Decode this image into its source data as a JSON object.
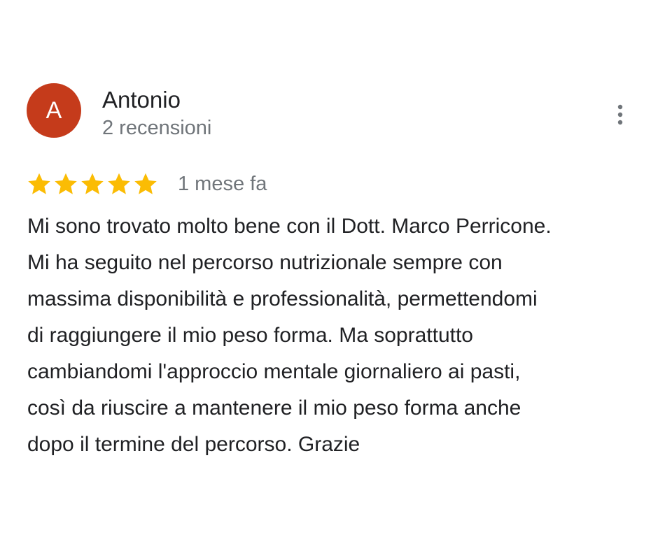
{
  "review": {
    "author": {
      "initial": "A",
      "name": "Antonio",
      "review_count": "2 recensioni",
      "avatar_color": "#c53b1b"
    },
    "more_icon": "more-vertical-icon",
    "rating": {
      "stars": 5,
      "max": 5,
      "icon": "star-icon",
      "color": "#fbbc04"
    },
    "date": "1 mese fa",
    "text_lines": [
      "Mi sono trovato molto bene con il Dott. Marco Perricone.",
      "Mi ha seguito nel percorso nutrizionale sempre con",
      "massima disponibilità e professionalità, permettendomi",
      "di raggiungere il mio peso forma. Ma soprattutto",
      "cambiandomi l'approccio mentale giornaliero ai pasti,",
      "così da riuscire a mantenere il mio peso forma anche",
      "dopo il termine del percorso. Grazie"
    ]
  }
}
